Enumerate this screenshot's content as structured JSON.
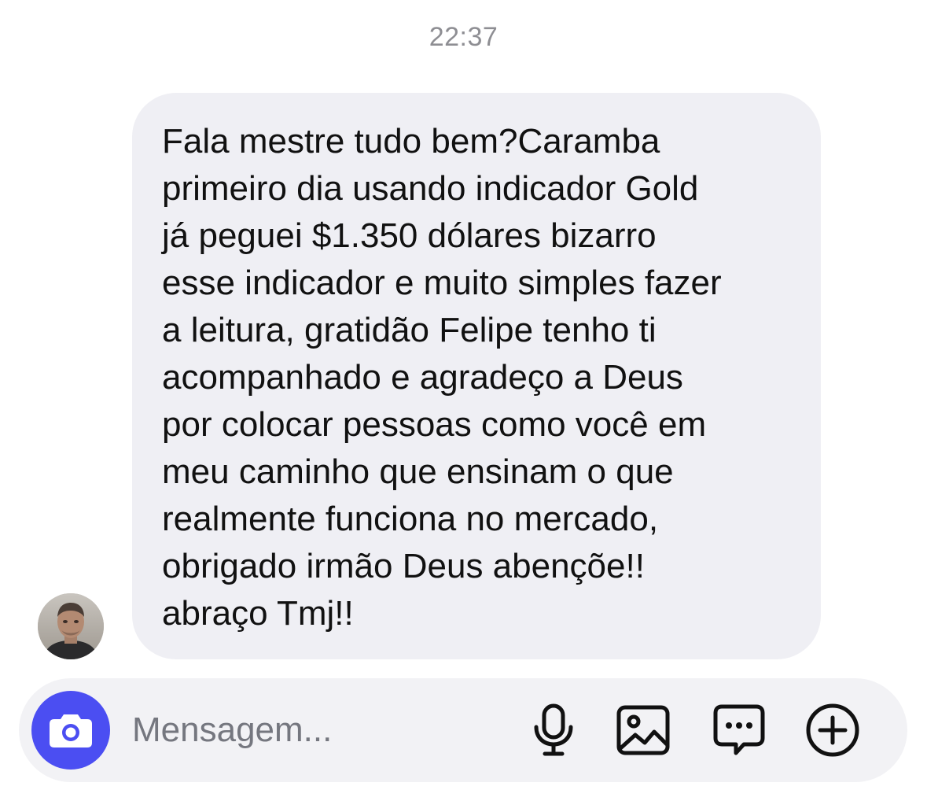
{
  "thread": {
    "timestamp": "22:37"
  },
  "message": {
    "text": "Fala mestre tudo bem?Caramba\nprimeiro dia usando indicador Gold\njá peguei $1.350 dólares bizarro\nesse indicador e muito simples fazer\na leitura, gratidão Felipe tenho ti\nacompanhado e agradeço a Deus\npor colocar pessoas como você em\nmeu caminho que ensinam o que\nrealmente funciona no mercado,\nobrigado irmão Deus abençõe!!\nabraço Tmj!!"
  },
  "composer": {
    "placeholder": "Mensagem...",
    "value": "",
    "icons": {
      "camera": "camera-icon",
      "mic": "microphone-icon",
      "gallery": "image-icon",
      "sticker": "chat-bubble-icon",
      "more": "plus-circle-icon"
    },
    "accent_color": "#4b4ef2"
  },
  "colors": {
    "bubble_bg": "#efeff4",
    "composer_bg": "#f2f2f5",
    "timestamp": "#8e8e93"
  }
}
